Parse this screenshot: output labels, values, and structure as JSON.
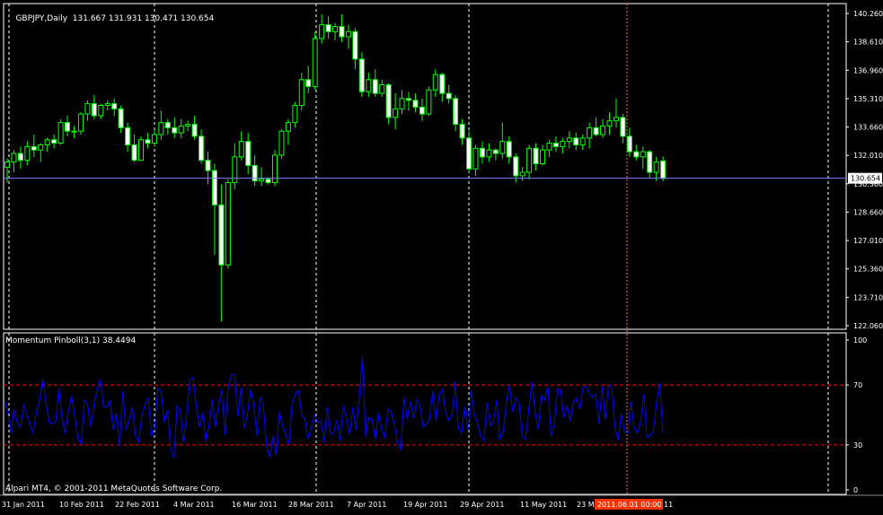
{
  "main_header": {
    "symbol_tf": "GBPJPY,Daily",
    "ohlc": "131.667 131.931 130.471 130.654"
  },
  "sub_header": {
    "label": "Momentum Pinboll(3,1) 38.4494"
  },
  "copyright": "Alpari MT4, © 2001-2011 MetaQuotes Software Corp.",
  "colors": {
    "background": "#000000",
    "grid": "#ffffff",
    "bull": "#000000",
    "bear": "#ffffff",
    "wick": "#00ff00",
    "momentum": "#0000ff",
    "levels": "#ff0000",
    "bid_line": "#7f7fff",
    "cursor": "#ff6a3d",
    "cursor_label_bg": "#ff3300"
  },
  "chart_data": [
    {
      "type": "candlestick",
      "title": "GBPJPY,Daily",
      "y_ticks": [
        "140.260",
        "138.610",
        "136.960",
        "135.310",
        "133.660",
        "132.010",
        "130.360",
        "128.660",
        "127.010",
        "125.360",
        "123.710",
        "122.060"
      ],
      "current_price_label": "130.654",
      "current_price": 130.654,
      "ylim": [
        122.06,
        140.26
      ],
      "x_labels": [
        "31 Jan 2011",
        "10 Feb 2011",
        "22 Feb 2011",
        "4 Mar 2011",
        "16 Mar 2011",
        "28 Mar 2011",
        "7 Apr 2011",
        "19 Apr 2011",
        "29 Apr 2011",
        "11 May 2011",
        "23 M",
        "2011.06.01 00:00",
        "11"
      ],
      "cursor_date_label": "2011.06.01 00:00",
      "candles": [
        [
          131.3,
          131.8,
          130.4,
          131.6
        ],
        [
          131.6,
          132.3,
          131.0,
          132.1
        ],
        [
          132.1,
          132.5,
          131.2,
          131.7
        ],
        [
          131.7,
          132.8,
          131.4,
          132.5
        ],
        [
          132.5,
          133.2,
          131.9,
          132.3
        ],
        [
          132.3,
          132.7,
          131.6,
          132.6
        ],
        [
          132.6,
          133.0,
          132.2,
          132.9
        ],
        [
          132.9,
          133.2,
          132.4,
          132.7
        ],
        [
          132.7,
          134.1,
          132.6,
          133.9
        ],
        [
          133.9,
          134.3,
          133.1,
          133.4
        ],
        [
          133.4,
          133.7,
          133.0,
          133.4
        ],
        [
          133.4,
          134.5,
          133.2,
          134.4
        ],
        [
          134.4,
          135.2,
          134.0,
          135.0
        ],
        [
          135.0,
          135.5,
          134.1,
          134.3
        ],
        [
          134.3,
          135.0,
          134.1,
          134.9
        ],
        [
          134.9,
          135.2,
          134.6,
          135.0
        ],
        [
          135.0,
          135.3,
          134.3,
          134.7
        ],
        [
          134.7,
          134.9,
          133.3,
          133.6
        ],
        [
          133.6,
          133.9,
          132.2,
          132.6
        ],
        [
          132.6,
          133.2,
          131.6,
          131.7
        ],
        [
          131.7,
          133.1,
          131.7,
          132.9
        ],
        [
          132.9,
          133.3,
          132.4,
          132.7
        ],
        [
          132.7,
          133.5,
          132.5,
          133.2
        ],
        [
          133.2,
          134.6,
          132.9,
          133.9
        ],
        [
          133.9,
          134.1,
          133.2,
          133.6
        ],
        [
          133.6,
          134.2,
          133.0,
          133.3
        ],
        [
          133.3,
          134.1,
          133.0,
          133.7
        ],
        [
          133.7,
          134.0,
          133.4,
          133.8
        ],
        [
          133.8,
          134.3,
          132.9,
          133.1
        ],
        [
          133.1,
          133.5,
          131.5,
          131.7
        ],
        [
          131.7,
          132.2,
          130.3,
          131.1
        ],
        [
          131.1,
          131.5,
          126.2,
          129.1
        ],
        [
          129.1,
          130.3,
          122.3,
          125.6
        ],
        [
          125.6,
          130.6,
          125.4,
          130.4
        ],
        [
          130.4,
          132.7,
          130.0,
          131.9
        ],
        [
          131.9,
          133.4,
          131.7,
          132.8
        ],
        [
          132.8,
          133.3,
          130.9,
          131.4
        ],
        [
          131.4,
          132.0,
          130.2,
          130.5
        ],
        [
          130.5,
          131.3,
          130.2,
          130.6
        ],
        [
          130.6,
          130.7,
          130.3,
          130.4
        ],
        [
          130.4,
          132.3,
          130.2,
          132.0
        ],
        [
          132.0,
          133.5,
          131.8,
          133.4
        ],
        [
          133.4,
          134.1,
          132.6,
          133.9
        ],
        [
          133.9,
          135.1,
          133.6,
          134.9
        ],
        [
          134.9,
          136.8,
          134.6,
          136.4
        ],
        [
          136.4,
          137.2,
          135.6,
          136.0
        ],
        [
          136.0,
          139.2,
          135.8,
          138.8
        ],
        [
          138.8,
          140.2,
          138.5,
          139.6
        ],
        [
          139.6,
          140.1,
          138.8,
          139.2
        ],
        [
          139.2,
          139.7,
          138.7,
          139.5
        ],
        [
          139.5,
          140.2,
          138.6,
          138.9
        ],
        [
          138.9,
          139.6,
          138.2,
          139.2
        ],
        [
          139.2,
          139.4,
          137.0,
          137.6
        ],
        [
          137.6,
          138.0,
          135.4,
          135.7
        ],
        [
          135.7,
          136.8,
          135.4,
          136.4
        ],
        [
          136.4,
          137.0,
          135.4,
          135.6
        ],
        [
          135.6,
          136.4,
          135.4,
          136.1
        ],
        [
          136.1,
          136.2,
          133.8,
          134.2
        ],
        [
          134.2,
          135.6,
          133.5,
          134.7
        ],
        [
          134.7,
          135.8,
          134.4,
          135.3
        ],
        [
          135.3,
          135.7,
          134.6,
          135.2
        ],
        [
          135.2,
          135.6,
          134.5,
          134.8
        ],
        [
          134.8,
          135.3,
          134.0,
          134.4
        ],
        [
          134.4,
          136.0,
          134.3,
          135.8
        ],
        [
          135.8,
          137.0,
          135.4,
          136.7
        ],
        [
          136.7,
          136.8,
          135.1,
          135.6
        ],
        [
          135.6,
          136.1,
          135.0,
          135.3
        ],
        [
          135.3,
          135.5,
          133.4,
          133.8
        ],
        [
          133.8,
          134.1,
          132.6,
          133.0
        ],
        [
          133.0,
          133.4,
          131.0,
          131.2
        ],
        [
          131.2,
          132.6,
          130.8,
          132.4
        ],
        [
          132.4,
          132.8,
          131.5,
          131.9
        ],
        [
          131.9,
          132.7,
          131.6,
          132.3
        ],
        [
          132.3,
          132.4,
          131.7,
          132.1
        ],
        [
          132.1,
          133.9,
          131.8,
          132.8
        ],
        [
          132.8,
          133.1,
          131.5,
          131.9
        ],
        [
          131.9,
          132.1,
          130.4,
          130.8
        ],
        [
          130.8,
          131.3,
          130.5,
          131.0
        ],
        [
          131.0,
          132.6,
          130.6,
          132.4
        ],
        [
          132.4,
          132.7,
          131.1,
          131.5
        ],
        [
          131.5,
          132.6,
          131.4,
          132.3
        ],
        [
          132.3,
          132.9,
          131.9,
          132.7
        ],
        [
          132.7,
          133.1,
          132.2,
          132.5
        ],
        [
          132.5,
          133.0,
          132.1,
          132.8
        ],
        [
          132.8,
          133.4,
          132.4,
          133.0
        ],
        [
          133.0,
          133.3,
          132.3,
          132.6
        ],
        [
          132.6,
          133.2,
          132.3,
          133.0
        ],
        [
          133.0,
          133.9,
          132.4,
          133.6
        ],
        [
          133.6,
          134.2,
          133.1,
          133.2
        ],
        [
          133.2,
          134.1,
          133.0,
          133.7
        ],
        [
          133.7,
          134.5,
          133.2,
          134.0
        ],
        [
          134.0,
          135.3,
          133.6,
          134.2
        ],
        [
          134.2,
          134.4,
          132.7,
          133.1
        ],
        [
          133.1,
          133.6,
          131.9,
          132.2
        ],
        [
          132.2,
          132.6,
          131.7,
          131.9
        ],
        [
          131.9,
          132.5,
          131.2,
          132.2
        ],
        [
          132.2,
          132.3,
          130.7,
          131.0
        ],
        [
          131.0,
          131.9,
          130.5,
          131.6
        ],
        [
          131.667,
          131.931,
          130.471,
          130.654
        ]
      ]
    },
    {
      "type": "line",
      "title": "Momentum Pinboll(3,1) 38.4494",
      "y_ticks": [
        "100",
        "70",
        "30",
        "0"
      ],
      "ylim": [
        0,
        100
      ],
      "levels": [
        70,
        30
      ],
      "series": [
        {
          "values": [
            60,
            52,
            38,
            54,
            45,
            42,
            57,
            50,
            43,
            38,
            52,
            60,
            74,
            58,
            45,
            44,
            45,
            68,
            48,
            38,
            52,
            63,
            49,
            34,
            31,
            60,
            57,
            42,
            57,
            67,
            74,
            56,
            55,
            59,
            40,
            51,
            29,
            66,
            40,
            47,
            55,
            36,
            32,
            50,
            57,
            61,
            36,
            41,
            68,
            65,
            45,
            53,
            27,
            21,
            56,
            53,
            32,
            50,
            73,
            75,
            56,
            42,
            52,
            32,
            43,
            60,
            42,
            57,
            67,
            37,
            69,
            77,
            77,
            49,
            68,
            41,
            50,
            67,
            57,
            36,
            62,
            56,
            29,
            22,
            36,
            23,
            52,
            43,
            37,
            30,
            57,
            64,
            66,
            50,
            47,
            34,
            41,
            50,
            45,
            46,
            32,
            55,
            37,
            38,
            47,
            33,
            56,
            48,
            37,
            55,
            40,
            62,
            89,
            35,
            48,
            47,
            34,
            52,
            40,
            35,
            54,
            52,
            44,
            31,
            27,
            62,
            47,
            59,
            48,
            60,
            56,
            42,
            44,
            47,
            66,
            46,
            63,
            67,
            52,
            46,
            50,
            72,
            41,
            38,
            56,
            40,
            66,
            51,
            44,
            36,
            33,
            58,
            43,
            46,
            60,
            34,
            38,
            58,
            70,
            52,
            61,
            58,
            36,
            34,
            53,
            72,
            52,
            40,
            63,
            60,
            69,
            36,
            43,
            67,
            67,
            48,
            56,
            46,
            59,
            61,
            54,
            68,
            69,
            64,
            62,
            64,
            44,
            69,
            47,
            70,
            68,
            42,
            33,
            51,
            39,
            38,
            59,
            42,
            38,
            45,
            64,
            35,
            36,
            39,
            58,
            71,
            38
          ]
        }
      ]
    }
  ]
}
